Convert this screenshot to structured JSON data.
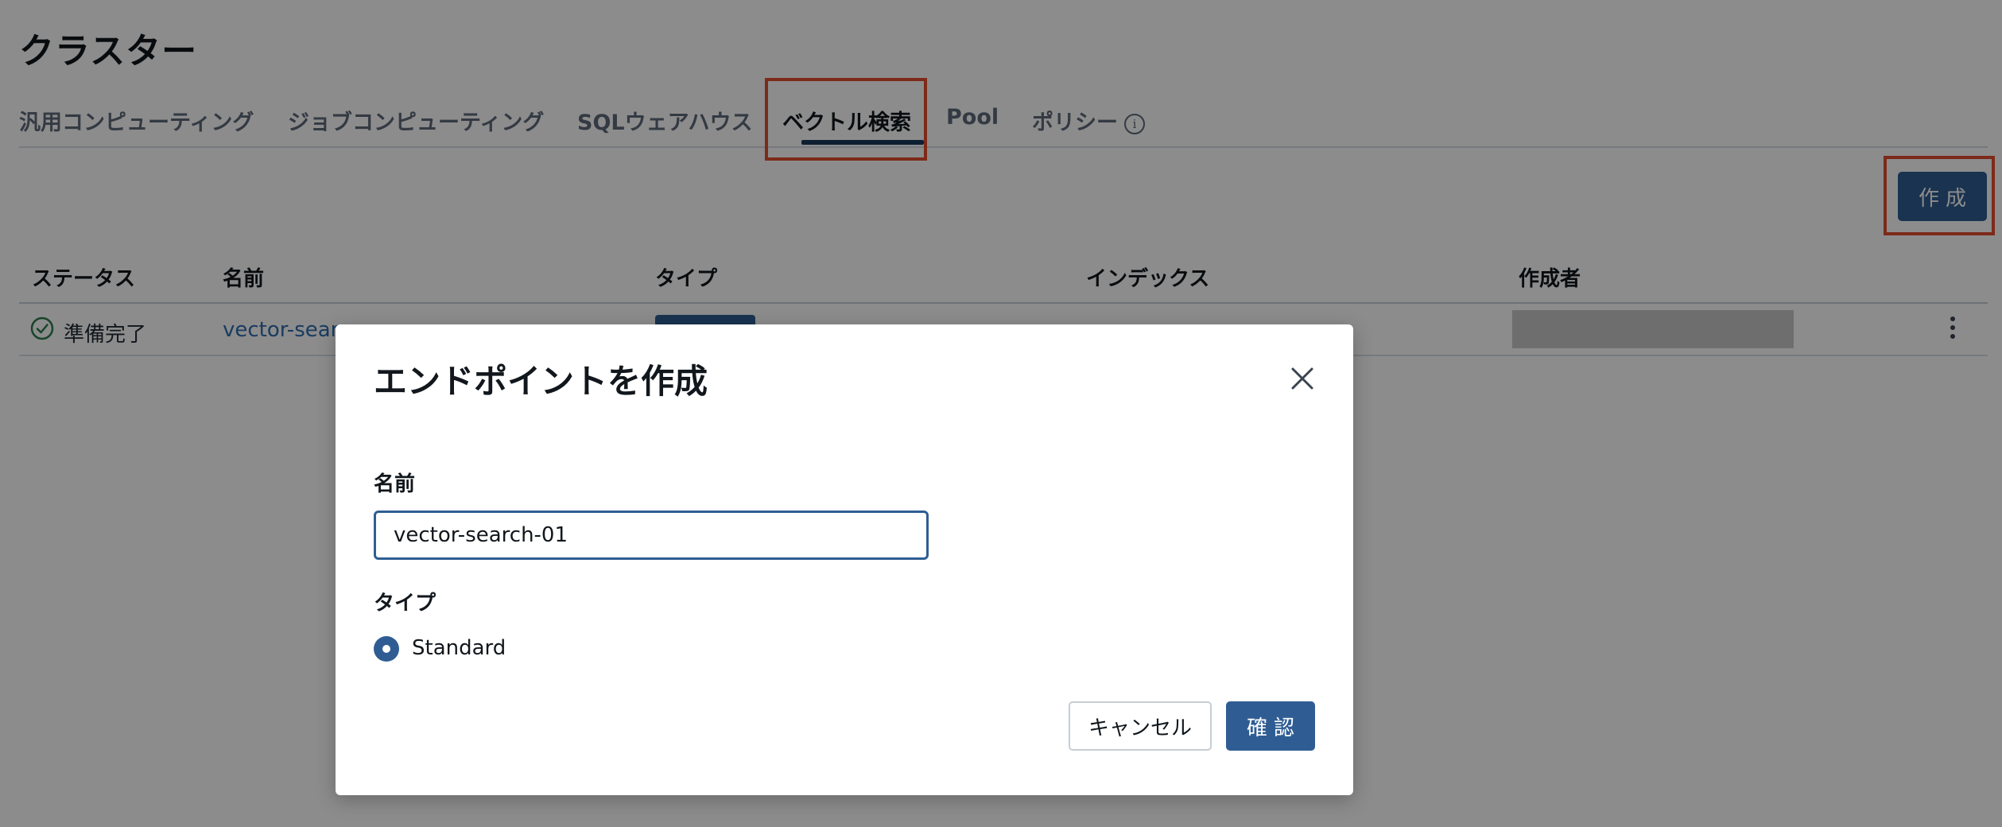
{
  "page": {
    "title": "クラスター"
  },
  "tabs": [
    {
      "label": "汎用コンピューティング",
      "active": false
    },
    {
      "label": "ジョブコンピューティング",
      "active": false
    },
    {
      "label": "SQLウェアハウス",
      "active": false
    },
    {
      "label": "ベクトル検索",
      "active": true
    },
    {
      "label": "Pool",
      "active": false
    },
    {
      "label": "ポリシー",
      "active": false,
      "icon": "info-icon"
    }
  ],
  "toolbar": {
    "create_label": "作成"
  },
  "table": {
    "columns": [
      "ステータス",
      "名前",
      "タイプ",
      "インデックス",
      "作成者"
    ],
    "rows": [
      {
        "status": "準備完了",
        "status_icon": "check-circle-icon",
        "name": "vector-sear"
      }
    ]
  },
  "modal": {
    "title": "エンドポイントを作成",
    "name_label": "名前",
    "name_value": "vector-search-01",
    "type_label": "タイプ",
    "type_option": "Standard",
    "cancel_label": "キャンセル",
    "confirm_label": "確認"
  },
  "colors": {
    "primary": "#2f5d93",
    "highlight": "#e34e2f",
    "overlay": "rgba(0,0,0,0.45)"
  }
}
